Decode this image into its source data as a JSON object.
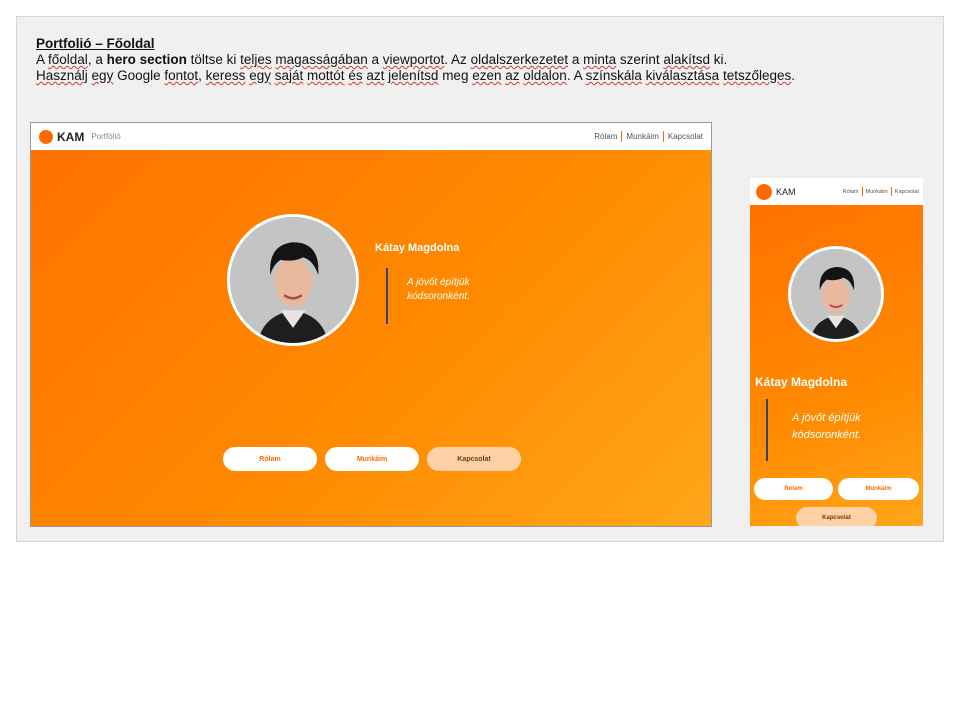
{
  "doc": {
    "title": "Portfolió – Főoldal",
    "line1_parts": [
      "A ",
      "főoldal",
      ", a ",
      "hero section",
      " töltse ki ",
      "teljes",
      " ",
      "magasságában",
      " a ",
      "viewportot",
      ". Az ",
      "oldalszerkezetet",
      " a ",
      "minta",
      " szerint ",
      "alakítsd",
      " ki."
    ],
    "line2_parts": [
      "Használj",
      " ",
      "egy",
      " Google ",
      "fontot",
      ", ",
      "keress",
      " ",
      "egy",
      " ",
      "saját",
      " ",
      "mottót",
      " ",
      "és",
      " ",
      "azt",
      " ",
      "jelenítsd",
      " meg ",
      "ezen",
      " ",
      "az",
      " ",
      "oldalon",
      ". A ",
      "színskála",
      " ",
      "kiválasztása",
      " ",
      "tetszőleges",
      "."
    ]
  },
  "desktop": {
    "brand": "KAM",
    "brand_sub": "Portfólió",
    "nav": [
      "Rólam",
      "Munkáim",
      "Kapcsolat"
    ],
    "name": "Kátay Magdolna",
    "motto_line1": "A jövőt építjük",
    "motto_line2": "kódsoronként.",
    "buttons": [
      "Rólam",
      "Munkáim",
      "Kapcsolat"
    ]
  },
  "mobile": {
    "brand": "KAM",
    "nav": [
      "Rólam",
      "Munkáim",
      "Kapcsolat"
    ],
    "name": "Kátay Magdolna",
    "motto_line1": "A jövőt építjük",
    "motto_line2": "kódsoronként.",
    "buttons": [
      "Rólam",
      "Munkáim",
      "Kapcsolat"
    ]
  },
  "colors": {
    "accent": "#ff6a00",
    "motto_bar": "#3a3f7a"
  }
}
